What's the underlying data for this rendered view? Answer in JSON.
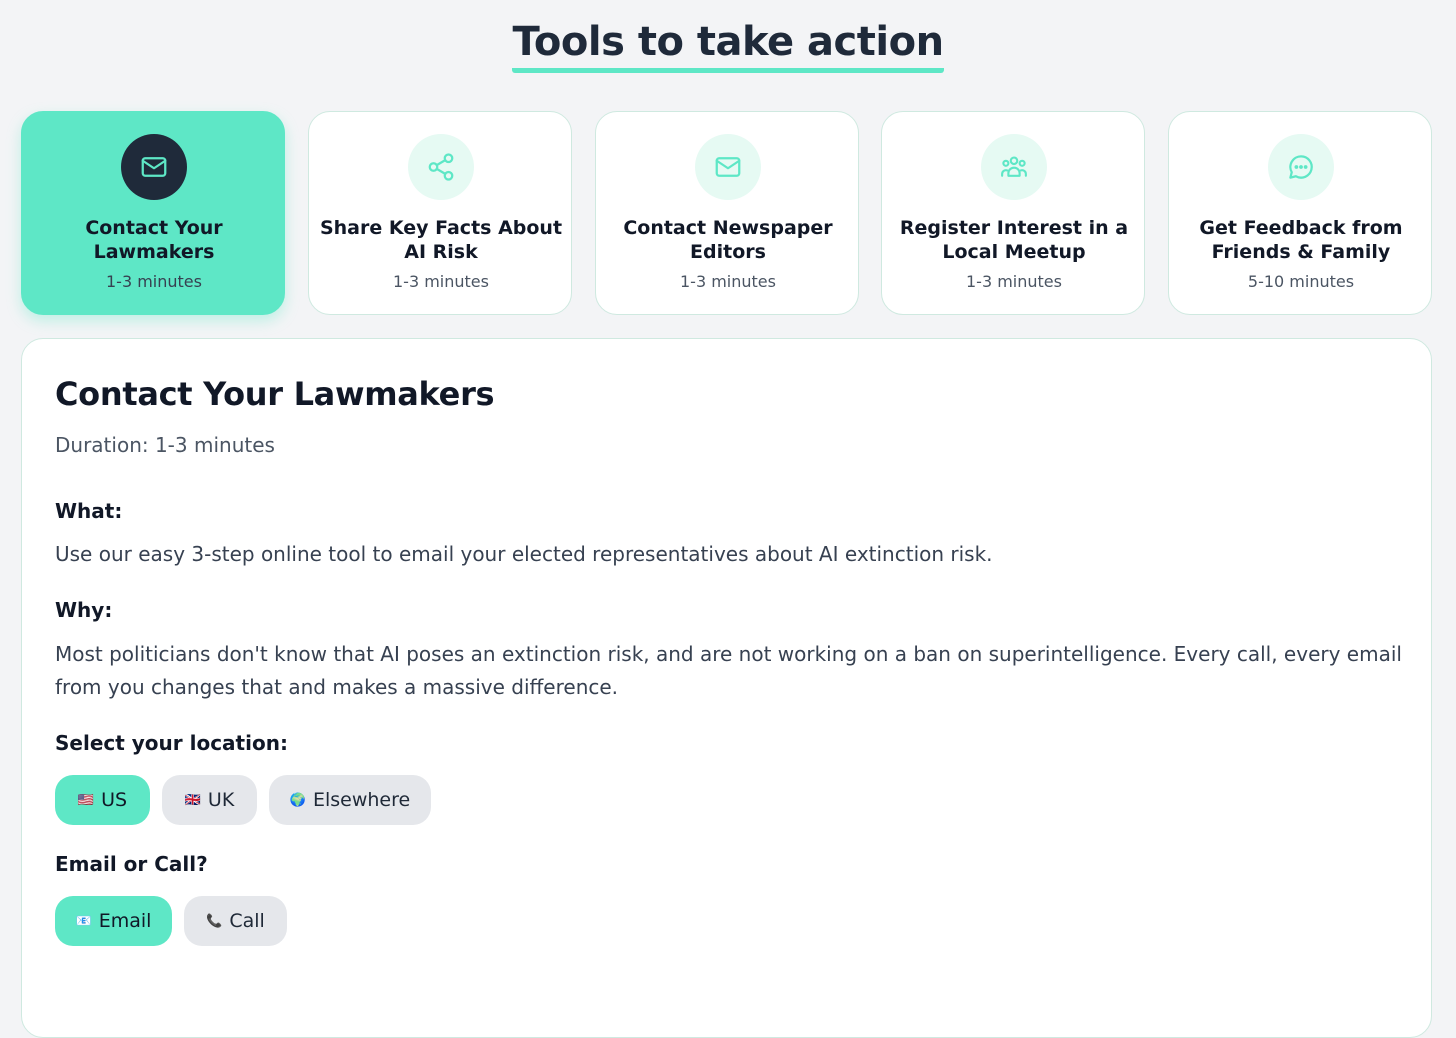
{
  "page": {
    "title": "Tools to take action"
  },
  "tools": [
    {
      "label": "Contact Your Lawmakers",
      "duration": "1-3 minutes",
      "icon": "mail-icon",
      "active": true
    },
    {
      "label": "Share Key Facts About AI Risk",
      "duration": "1-3 minutes",
      "icon": "share-icon",
      "active": false
    },
    {
      "label": "Contact Newspaper Editors",
      "duration": "1-3 minutes",
      "icon": "mail-icon",
      "active": false
    },
    {
      "label": "Register Interest in a Local Meetup",
      "duration": "1-3 minutes",
      "icon": "group-icon",
      "active": false
    },
    {
      "label": "Get Feedback from Friends & Family",
      "duration": "5-10 minutes",
      "icon": "chat-bubble-icon",
      "active": false
    }
  ],
  "detail": {
    "title": "Contact Your Lawmakers",
    "duration": "Duration: 1-3 minutes",
    "what_heading": "What:",
    "what_text": "Use our easy 3-step online tool to email your elected representatives about AI extinction risk.",
    "why_heading": "Why:",
    "why_text": "Most politicians don't know that AI poses an extinction risk, and are not working on a ban on superintelligence. Every call, every email from you changes that and makes a massive difference.",
    "location_heading": "Select your location:",
    "locations": [
      {
        "flag": "🇺🇸",
        "label": "US",
        "selected": true
      },
      {
        "flag": "🇬🇧",
        "label": "UK",
        "selected": false
      },
      {
        "flag": "🌍",
        "label": "Elsewhere",
        "selected": false
      }
    ],
    "method_heading": "Email or Call?",
    "methods": [
      {
        "flag": "📧",
        "label": "Email",
        "selected": true
      },
      {
        "flag": "📞",
        "label": "Call",
        "selected": false
      }
    ]
  },
  "colors": {
    "accent": "#5ee7c6",
    "dark": "#1f2a3a",
    "background": "#f3f4f6"
  }
}
